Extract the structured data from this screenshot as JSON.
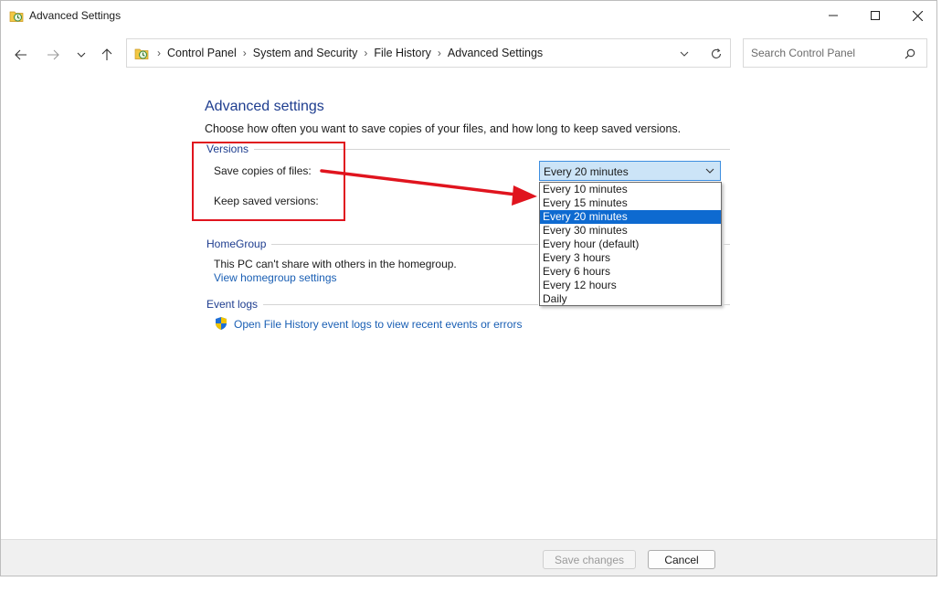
{
  "window": {
    "title": "Advanced Settings"
  },
  "addressbar": {
    "crumbs": [
      "Control Panel",
      "System and Security",
      "File History",
      "Advanced Settings"
    ]
  },
  "search": {
    "placeholder": "Search Control Panel"
  },
  "content": {
    "heading": "Advanced settings",
    "description": "Choose how often you want to save copies of your files, and how long to keep saved versions.",
    "versions": {
      "group_label": "Versions",
      "save_copies_label": "Save copies of files:",
      "keep_versions_label": "Keep saved versions:",
      "selected_value": "Every 20 minutes",
      "options": [
        "Every 10 minutes",
        "Every 15 minutes",
        "Every 20 minutes",
        "Every 30 minutes",
        "Every hour (default)",
        "Every 3 hours",
        "Every 6 hours",
        "Every 12 hours",
        "Daily"
      ],
      "selected_index": 2
    },
    "homegroup": {
      "group_label": "HomeGroup",
      "status_text": "This PC can't share with others in the homegroup.",
      "settings_link": "View homegroup settings"
    },
    "eventlogs": {
      "group_label": "Event logs",
      "link": "Open File History event logs to view recent events or errors"
    }
  },
  "footer": {
    "save_label": "Save changes",
    "cancel_label": "Cancel"
  },
  "colors": {
    "accent": "#1e3d8f",
    "link": "#1a5fb4",
    "selection": "#0e6ad0",
    "annotation": "#e0141e"
  }
}
